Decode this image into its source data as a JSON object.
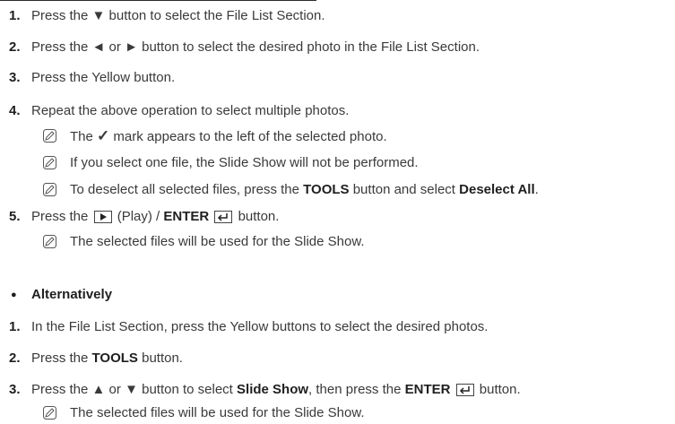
{
  "steps": [
    {
      "n": "1.",
      "pre": "Press the ",
      "sym": "▼",
      "post": " button to select the File List Section."
    },
    {
      "n": "2.",
      "pre": "Press the ",
      "sym": "◄",
      "mid": " or ",
      "sym2": "►",
      "post": " button to select the desired photo in the File List Section."
    },
    {
      "n": "3.",
      "text": "Press the Yellow button."
    },
    {
      "n": "4.",
      "text": "Repeat the above operation to select multiple photos."
    }
  ],
  "notes4": [
    {
      "pre": "The ",
      "sym": "✓",
      "post": " mark appears to the left of the selected photo."
    },
    {
      "text": "If you select one file, the Slide Show will not be performed."
    },
    {
      "pre": "To deselect all selected files, press the ",
      "b1": "TOOLS",
      "mid": " button and select ",
      "b2": "Deselect All",
      "post": "."
    }
  ],
  "step5": {
    "n": "5.",
    "pre": "Press the ",
    "play_label": "(Play) / ",
    "enter": "ENTER",
    "post": " button."
  },
  "note5": "The selected files will be used for the Slide Show.",
  "alt_heading": {
    "bullet": "●",
    "text": "Alternatively"
  },
  "alt_steps": [
    {
      "n": "1.",
      "text": "In the File List Section, press the Yellow buttons to select the desired photos."
    },
    {
      "n": "2.",
      "pre": "Press the ",
      "b": "TOOLS",
      "post": " button."
    },
    {
      "n": "3.",
      "pre": "Press the ",
      "sym": "▲",
      "mid": " or ",
      "sym2": "▼",
      "mid2": " button to select ",
      "b1": "Slide Show",
      "mid3": ", then press the ",
      "b2": "ENTER",
      "post": " button."
    }
  ],
  "note_alt3": "The selected files will be used for the Slide Show.",
  "icons": {
    "note": "memo-pencil-icon",
    "play": "play-key-icon",
    "enter": "enter-key-icon"
  }
}
